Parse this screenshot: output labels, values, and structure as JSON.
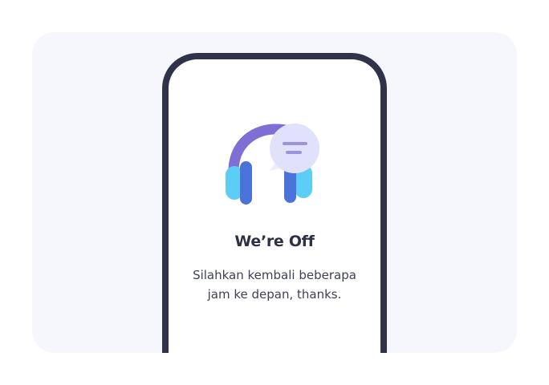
{
  "offline_screen": {
    "title": "We’re Off",
    "message_lines": [
      "Silahkan kembali beberapa",
      "jam ke depan, thanks."
    ],
    "illustration_icon": "headphones-chat-bubble-icon"
  },
  "colors": {
    "page_background": "#ffffff",
    "card_background": "#f6f7fc",
    "phone_frame": "#30324a",
    "title_text": "#2e3045",
    "body_text": "#3f4156",
    "headband_purple": "#7f6fd4",
    "earcup_cyan": "#5ccdf5",
    "earcup_blue": "#4a72d8",
    "bubble_lavender": "#e2e1fb",
    "bubble_lines": "#9b93de"
  }
}
